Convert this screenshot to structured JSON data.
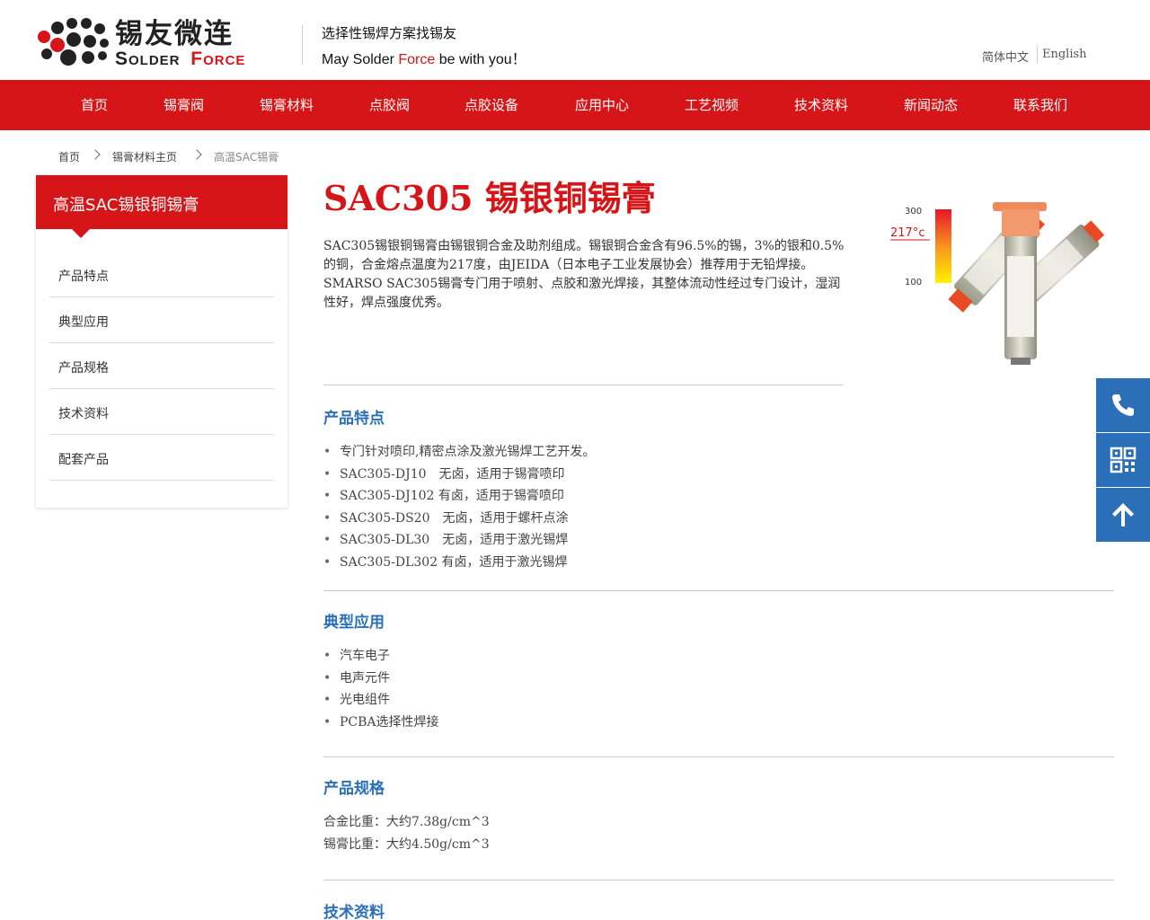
{
  "brand": {
    "name_cn": "锡友微连",
    "name_en_1": "Solder",
    "name_en_2": "Force",
    "slogan_cn": "选择性锡焊方案找锡友",
    "slogan_en_1": "May Solder ",
    "slogan_en_2": "Force",
    "slogan_en_3": " be with you！",
    "accent": "#d61518"
  },
  "lang": {
    "cn": "简体中文",
    "en": "English"
  },
  "nav": [
    "首页",
    "锡膏阀",
    "锡膏材料",
    "点胶阀",
    "点胶设备",
    "应用中心",
    "工艺视频",
    "技术资料",
    "新闻动态",
    "联系我们"
  ],
  "breadcrumb": [
    "首页",
    "锡膏材料主页",
    "高温SAC锡膏"
  ],
  "sidebar": {
    "title": "高温SAC锡银铜锡膏",
    "items": [
      "产品特点",
      "典型应用",
      "产品规格",
      "技术资料",
      "配套产品"
    ]
  },
  "product": {
    "title": "SAC305 锡银铜锡膏",
    "intro": "SAC305锡银铜锡膏由锡银铜合金及助剂组成。锡银铜合金含有96.5%的锡，3%的银和0.5%的铜，合金熔点温度为217度，由JEIDA（日本电子工业发展协会）推荐用于无铅焊接。SMARSO SAC305锡膏专门用于喷射、点胶和激光焊接，其整体流动性经过专门设计，湿润性好，焊点强度优秀。",
    "image": {
      "label_300": "300",
      "label_217": "217°c",
      "label_100": "100"
    }
  },
  "sections": {
    "features": {
      "title": "产品特点",
      "items": [
        "专门针对喷印,精密点涂及激光锡焊工艺开发。",
        "SAC305-DJ10　无卤，适用于锡膏喷印",
        "SAC305-DJ102 有卤，适用于锡膏喷印",
        "SAC305-DS20　无卤，适用于螺杆点涂",
        "SAC305-DL30　无卤，适用于激光锡焊",
        "SAC305-DL302 有卤，适用于激光锡焊"
      ]
    },
    "applications": {
      "title": "典型应用",
      "items": [
        "汽车电子",
        "电声元件",
        "光电组件",
        "PCBA选择性焊接"
      ]
    },
    "specs": {
      "title": "产品规格",
      "items": [
        "合金比重：大约7.38g/cm^3",
        "锡膏比重：大约4.50g/cm^3"
      ]
    },
    "tech": {
      "title": "技术资料"
    }
  },
  "float": {
    "color": "#2a6fb8",
    "icons": [
      "phone-icon",
      "qrcode-icon",
      "arrow-up-icon"
    ]
  }
}
